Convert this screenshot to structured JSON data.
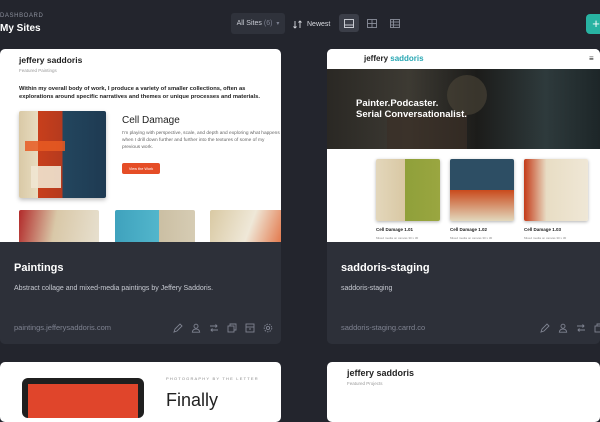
{
  "header": {
    "breadcrumb": "DASHBOARD",
    "title": "My Sites",
    "filter": {
      "label": "All Sites",
      "count": "(6)"
    },
    "sort_label": "Newest",
    "add_label": "+"
  },
  "sites": [
    {
      "name": "Paintings",
      "description": "Abstract collage and mixed-media paintings by Jeffery Saddoris.",
      "url": "paintings.jefferysaddoris.com",
      "preview": {
        "brand": "jeffery saddoris",
        "subtitle": "Featured Paintings",
        "intro": "Within my overall body of work, I produce a variety of smaller collections, often as explorations around specific narratives and themes or unique processes and materials.",
        "heading": "Cell Damage",
        "body": "I'm playing with perspective, scale, and depth and exploring what happens when I drill down further and further into the textures of some of my previous work.",
        "button": "View the Work"
      }
    },
    {
      "name": "saddoris-staging",
      "description": "saddoris-staging",
      "url": "saddoris-staging.carrd.co",
      "preview": {
        "brand_first": "jeffery",
        "brand_second": "saddoris",
        "menu": "≡",
        "tagline_1": "Painter.Podcaster.",
        "tagline_2": "Serial Conversationalist.",
        "items": [
          {
            "title": "Cell Damage 1.01",
            "sub": "Mixed media on canvas 30 x 30"
          },
          {
            "title": "Cell Damage 1.02",
            "sub": "Mixed media on canvas 30 x 30"
          },
          {
            "title": "Cell Damage 1.03",
            "sub": "Mixed media on canvas 30 x 30"
          }
        ]
      }
    },
    {
      "preview": {
        "eyebrow": "PHOTOGRAPHY BY THE LETTER",
        "heading": "Finally"
      }
    },
    {
      "preview": {
        "brand": "jeffery saddoris",
        "subtitle": "Featured Projects"
      }
    }
  ],
  "icons": [
    "chevron-down-icon",
    "sort-icon",
    "layout-large-icon",
    "layout-grid-icon",
    "layout-list-icon",
    "plus-icon",
    "edit-icon",
    "user-icon",
    "transfer-icon",
    "duplicate-icon",
    "archive-icon",
    "settings-icon"
  ],
  "colors": {
    "accent": "#28b3a2",
    "background": "#23252d",
    "card": "#2d3039",
    "cta": "#e54d26"
  }
}
